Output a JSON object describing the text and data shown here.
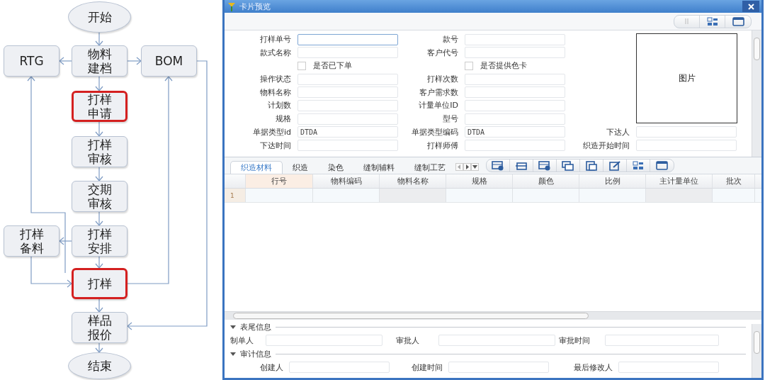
{
  "flowchart": {
    "nodes": [
      {
        "lines": [
          "开始"
        ],
        "kind": "terminal",
        "highlighted": false
      },
      {
        "lines": [
          "RTG"
        ],
        "kind": "process",
        "highlighted": false
      },
      {
        "lines": [
          "物料",
          "建档"
        ],
        "kind": "process",
        "highlighted": false
      },
      {
        "lines": [
          "BOM"
        ],
        "kind": "process",
        "highlighted": false
      },
      {
        "lines": [
          "打样",
          "申请"
        ],
        "kind": "process",
        "highlighted": true
      },
      {
        "lines": [
          "打样",
          "审核"
        ],
        "kind": "process",
        "highlighted": false
      },
      {
        "lines": [
          "交期",
          "审核"
        ],
        "kind": "process",
        "highlighted": false
      },
      {
        "lines": [
          "打样",
          "备料"
        ],
        "kind": "process",
        "highlighted": false
      },
      {
        "lines": [
          "打样",
          "安排"
        ],
        "kind": "process",
        "highlighted": false
      },
      {
        "lines": [
          "打样"
        ],
        "kind": "process",
        "highlighted": true
      },
      {
        "lines": [
          "样品",
          "报价"
        ],
        "kind": "process",
        "highlighted": false
      },
      {
        "lines": [
          "结束"
        ],
        "kind": "terminal",
        "highlighted": false
      }
    ]
  },
  "window": {
    "title": "卡片预览",
    "form": {
      "rows": [
        {
          "cells": [
            {
              "kind": "field",
              "label": "打样单号",
              "focused": true
            },
            {
              "kind": "field",
              "label": "款号",
              "focused": false
            }
          ]
        },
        {
          "cells": [
            {
              "kind": "field",
              "label": "款式名称",
              "focused": false
            },
            {
              "kind": "field",
              "label": "客户代号",
              "focused": false
            }
          ]
        },
        {
          "cells": [
            {
              "kind": "checkbox",
              "label": "是否已下单",
              "checked": false
            },
            {
              "kind": "checkbox",
              "label": "是否提供色卡",
              "checked": false
            }
          ]
        },
        {
          "cells": [
            {
              "kind": "field",
              "label": "操作状态",
              "focused": false
            },
            {
              "kind": "field",
              "label": "打样次数",
              "focused": false
            }
          ]
        },
        {
          "cells": [
            {
              "kind": "field",
              "label": "物料名称",
              "focused": false
            },
            {
              "kind": "field",
              "label": "客户需求数",
              "focused": false
            }
          ]
        },
        {
          "cells": [
            {
              "kind": "field",
              "label": "计划数",
              "focused": false
            },
            {
              "kind": "field",
              "label": "计量单位ID",
              "focused": false
            }
          ]
        },
        {
          "cells": [
            {
              "kind": "field",
              "label": "规格",
              "focused": false
            },
            {
              "kind": "field",
              "label": "型号",
              "focused": false
            }
          ]
        },
        {
          "cells": [
            {
              "kind": "field",
              "label": "单据类型id",
              "value": "DTDA",
              "focused": false
            },
            {
              "kind": "field",
              "label": "单据类型编码",
              "value": "DTDA",
              "focused": false
            },
            {
              "kind": "field",
              "label": "下达人",
              "focused": false
            }
          ]
        },
        {
          "cells": [
            {
              "kind": "field",
              "label": "下达时间",
              "focused": false
            },
            {
              "kind": "field",
              "label": "打样师傅",
              "focused": false
            },
            {
              "kind": "field",
              "label": "织造开始时间",
              "focused": false
            }
          ]
        }
      ],
      "picture": {
        "label": "图片"
      }
    },
    "tabs": [
      {
        "label": "织造材料",
        "selected": true
      },
      {
        "label": "织造",
        "selected": false
      },
      {
        "label": "染色",
        "selected": false
      },
      {
        "label": "缝制辅料",
        "selected": false
      },
      {
        "label": "缝制工艺",
        "selected": false
      }
    ],
    "grid": {
      "columns": [
        "行号",
        "物料编码",
        "物料名称",
        "规格",
        "颜色",
        "比例",
        "主计量单位",
        "批次"
      ],
      "rows": [
        {
          "number": "1"
        }
      ]
    },
    "sections": [
      {
        "title": "表尾信息",
        "expanded": true,
        "fields": [
          {
            "label": "制单人"
          },
          {
            "label": "审批人"
          },
          {
            "label": "审批时间"
          }
        ]
      },
      {
        "title": "审计信息",
        "expanded": true,
        "fields": [
          {
            "label": "创建人"
          },
          {
            "label": "创建时间"
          },
          {
            "label": "最后修改人"
          }
        ]
      }
    ]
  }
}
